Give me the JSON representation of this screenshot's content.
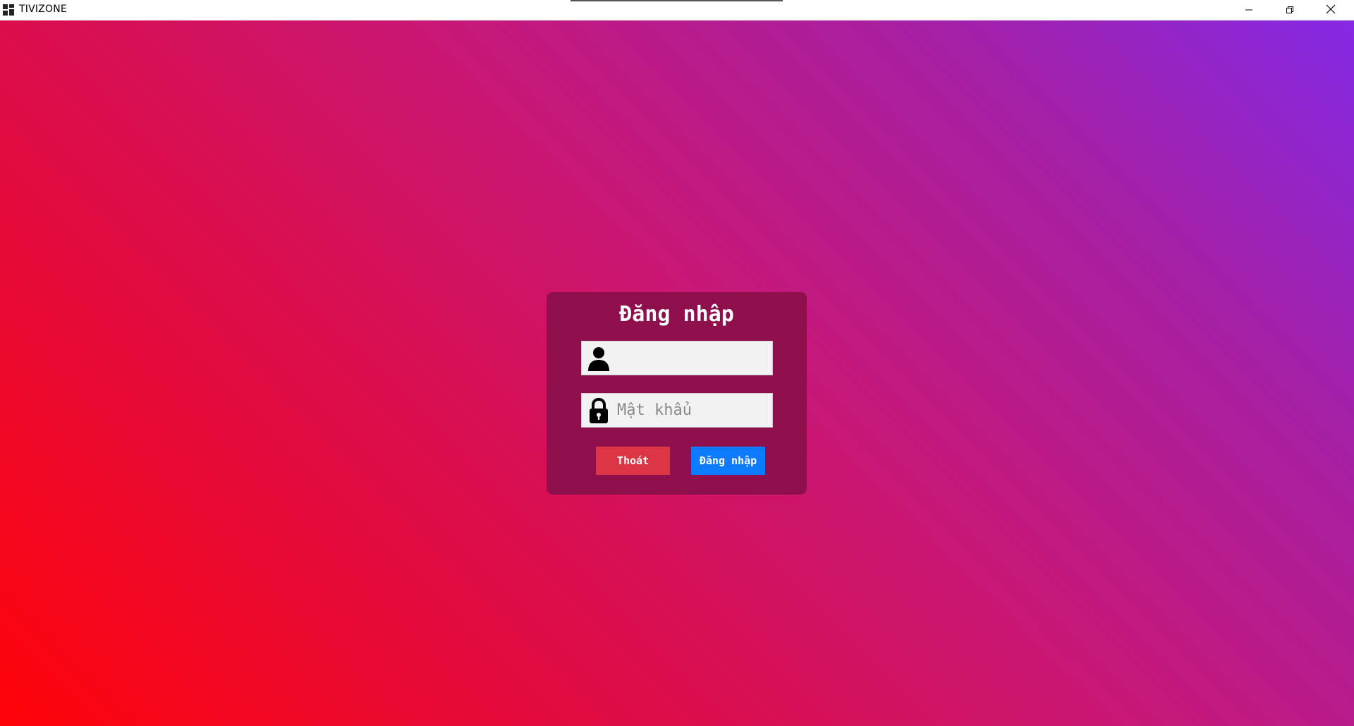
{
  "window": {
    "title": "TIVIZONE",
    "controls": {
      "minimize": "minimize-icon",
      "maximize": "restore-icon",
      "close": "close-icon"
    }
  },
  "colors": {
    "gradient_start": "#ff0308",
    "gradient_end": "#8429e4",
    "card_bg": "#8e0f4b",
    "exit_button": "#dc3545",
    "login_button": "#0d7bff"
  },
  "login": {
    "title": "Đăng nhập",
    "username": {
      "icon": "user-icon",
      "value": "",
      "placeholder": ""
    },
    "password": {
      "icon": "lock-icon",
      "value": "",
      "placeholder": "Mật khẩu"
    },
    "exit_label": "Thoát",
    "submit_label": "Đăng nhập"
  }
}
